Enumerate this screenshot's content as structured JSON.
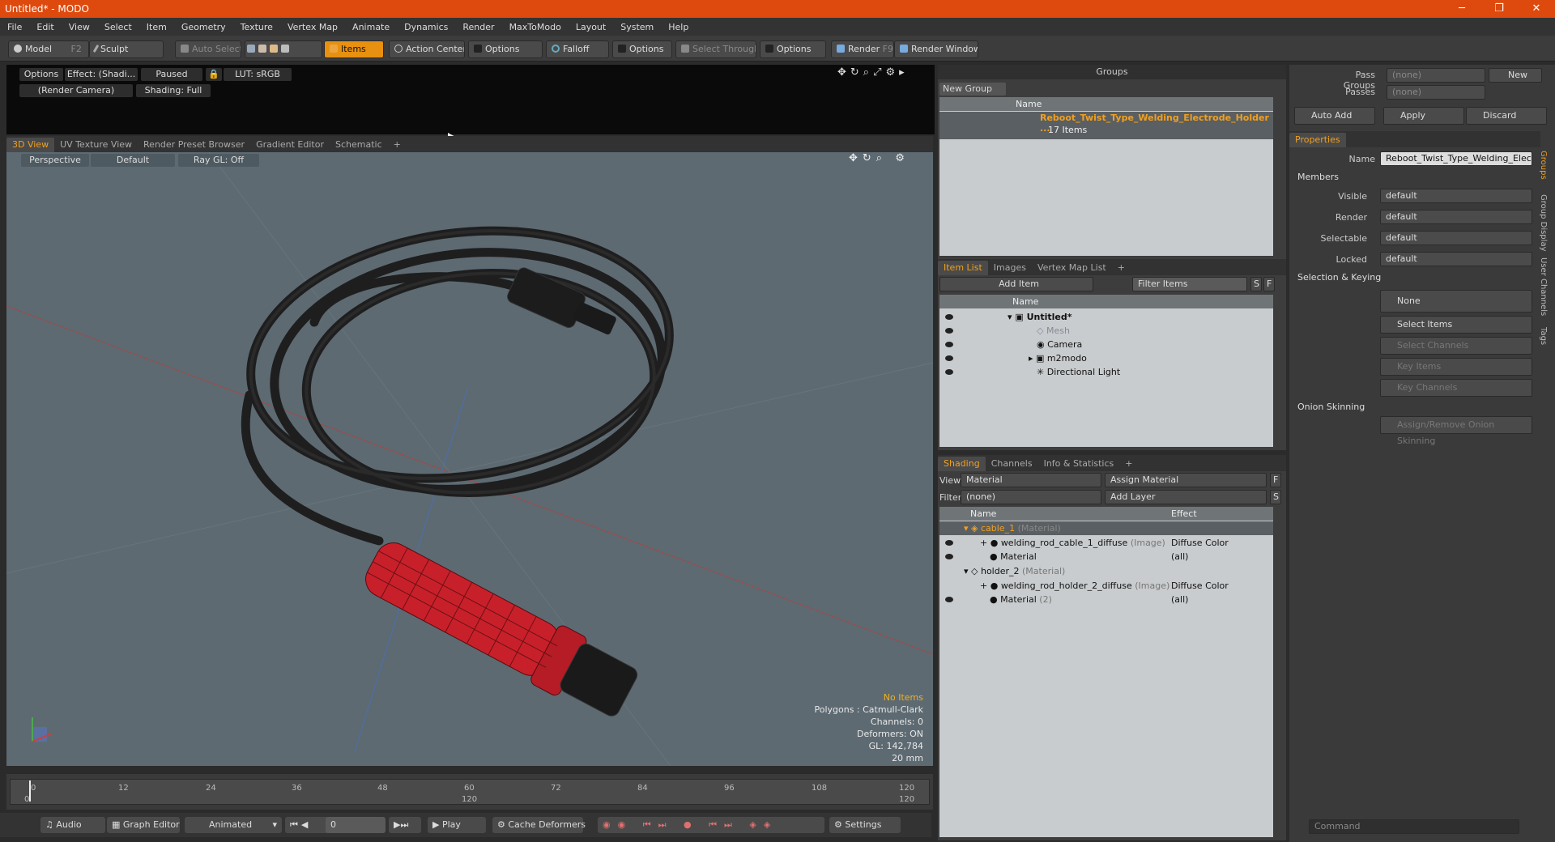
{
  "window": {
    "title": "Untitled* - MODO",
    "min": "─",
    "max": "❐",
    "close": "✕"
  },
  "menu": [
    "File",
    "Edit",
    "View",
    "Select",
    "Item",
    "Geometry",
    "Texture",
    "Vertex Map",
    "Animate",
    "Dynamics",
    "Render",
    "MaxToModo",
    "Layout",
    "System",
    "Help"
  ],
  "toolbar": {
    "model": "Model",
    "model_key": "F2",
    "sculpt": "Sculpt",
    "auto_select": "Auto Select",
    "items": "Items",
    "action_center": "Action Center",
    "options1": "Options",
    "falloff": "Falloff",
    "options2": "Options",
    "select_through": "Select Through",
    "options3": "Options",
    "render": "Render",
    "render_key": "F9",
    "render_window": "Render Window"
  },
  "preview": {
    "options": "Options",
    "effect": "Effect: (Shadi...",
    "paused": "Paused",
    "lut": "LUT: sRGB",
    "camera": "(Render Camera)",
    "shading": "Shading: Full"
  },
  "view_tabs": [
    "3D View",
    "UV Texture View",
    "Render Preset Browser",
    "Gradient Editor",
    "Schematic",
    "+"
  ],
  "viewport": {
    "projection": "Perspective",
    "style": "Default",
    "raygl": "Ray GL: Off"
  },
  "stats": {
    "no_items": "No Items",
    "polygons": "Polygons : Catmull-Clark",
    "channels": "Channels: 0",
    "deformers": "Deformers: ON",
    "gl": "GL: 142,784",
    "scale": "20 mm"
  },
  "timeline": {
    "ticks": [
      "0",
      "12",
      "24",
      "36",
      "48",
      "60",
      "72",
      "84",
      "96",
      "108",
      "120"
    ],
    "sub_start": "0",
    "sub_mid": "120",
    "sub_end": "120"
  },
  "bottom": {
    "audio": "Audio",
    "graph_editor": "Graph Editor",
    "animated": "Animated",
    "frame": "0",
    "play": "Play",
    "cache": "Cache Deformers",
    "settings": "Settings"
  },
  "groups": {
    "title": "Groups",
    "new_group": "New Group",
    "col_name": "Name",
    "item_name": "Reboot_Twist_Type_Welding_Electrode_Holder ...",
    "item_count": "17 Items"
  },
  "item_list": {
    "tabs": [
      "Item List",
      "Images",
      "Vertex Map List",
      "+"
    ],
    "add_item": "Add Item",
    "filter": "Filter Items",
    "s": "S",
    "f": "F",
    "col_name": "Name",
    "items": [
      {
        "name": "Untitled*",
        "level": 0
      },
      {
        "name": "Mesh",
        "level": 1
      },
      {
        "name": "Camera",
        "level": 1
      },
      {
        "name": "m2modo",
        "level": 1
      },
      {
        "name": "Directional Light",
        "level": 1
      }
    ]
  },
  "shading": {
    "tabs": [
      "Shading",
      "Channels",
      "Info & Statistics",
      "+"
    ],
    "view_label": "View",
    "view_value": "Material",
    "assign": "Assign Material",
    "f": "F",
    "filter_label": "Filter",
    "filter_value": "(none)",
    "add_layer": "Add Layer",
    "s": "S",
    "col_name": "Name",
    "col_effect": "Effect",
    "rows": [
      {
        "name": "cable_1",
        "tag": "(Material)",
        "effect": ""
      },
      {
        "name": "welding_rod_cable_1_diffuse",
        "tag": "(Image)",
        "effect": "Diffuse Color"
      },
      {
        "name": "Material",
        "tag": "",
        "effect": "(all)"
      },
      {
        "name": "holder_2",
        "tag": "(Material)",
        "effect": ""
      },
      {
        "name": "welding_rod_holder_2_diffuse",
        "tag": "(Image)",
        "effect": "Diffuse Color"
      },
      {
        "name": "Material",
        "tag": "(2)",
        "effect": "(all)"
      }
    ]
  },
  "props": {
    "pass_groups": "Pass Groups",
    "passes": "Passes",
    "none": "(none)",
    "new": "New",
    "auto_add": "Auto Add",
    "apply": "Apply",
    "discard": "Discard",
    "tab": "Properties",
    "name_label": "Name",
    "name_value": "Reboot_Twist_Type_Welding_Electro",
    "members": "Members",
    "fields": [
      {
        "label": "Visible",
        "value": "default"
      },
      {
        "label": "Render",
        "value": "default"
      },
      {
        "label": "Selectable",
        "value": "default"
      },
      {
        "label": "Locked",
        "value": "default"
      }
    ],
    "selection_keying": "Selection & Keying",
    "none_btn": "None",
    "select_items": "Select Items",
    "select_channels": "Select Channels",
    "key_items": "Key Items",
    "key_channels": "Key Channels",
    "onion": "Onion Skinning",
    "onion_btn": "Assign/Remove Onion Skinning",
    "side_tabs": [
      "Groups",
      "Group Display",
      "User Channels",
      "Tags"
    ],
    "command": "Command"
  },
  "colors": {
    "accent": "#e8900f",
    "title": "#de4a0e",
    "viewport": "#5d6a72",
    "holder": "#c8202a"
  }
}
